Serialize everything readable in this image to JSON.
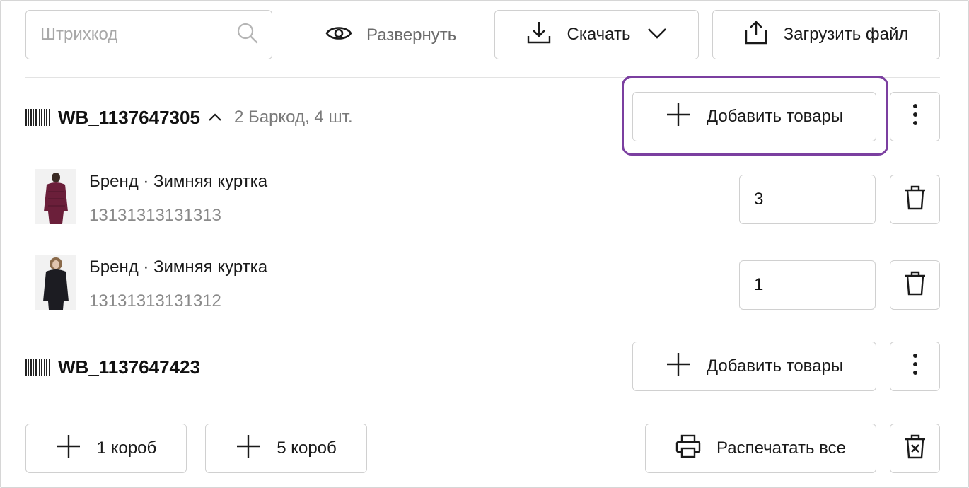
{
  "toolbar": {
    "search_placeholder": "Штрихкод",
    "expand_label": "Развернуть",
    "download_label": "Скачать",
    "upload_label": "Загрузить файл"
  },
  "boxes": [
    {
      "name": "WB_1137647305",
      "meta": "2 Баркод, 4 шт.",
      "add_label": "Добавить товары",
      "expanded": true,
      "items": [
        {
          "title": "Бренд · Зимняя куртка",
          "code": "13131313131313",
          "qty": "3",
          "thumb_color": "#6b1f3a"
        },
        {
          "title": "Бренд · Зимняя куртка",
          "code": "13131313131312",
          "qty": "1",
          "thumb_color": "#1c1c22"
        }
      ]
    },
    {
      "name": "WB_1137647423",
      "add_label": "Добавить товары",
      "expanded": false
    }
  ],
  "footer": {
    "add_one_label": "1 короб",
    "add_five_label": "5 короб",
    "print_all_label": "Распечатать все"
  },
  "colors": {
    "highlight": "#7b3fa0",
    "border": "#d0d0d0",
    "muted_text": "#7a7a7a"
  }
}
